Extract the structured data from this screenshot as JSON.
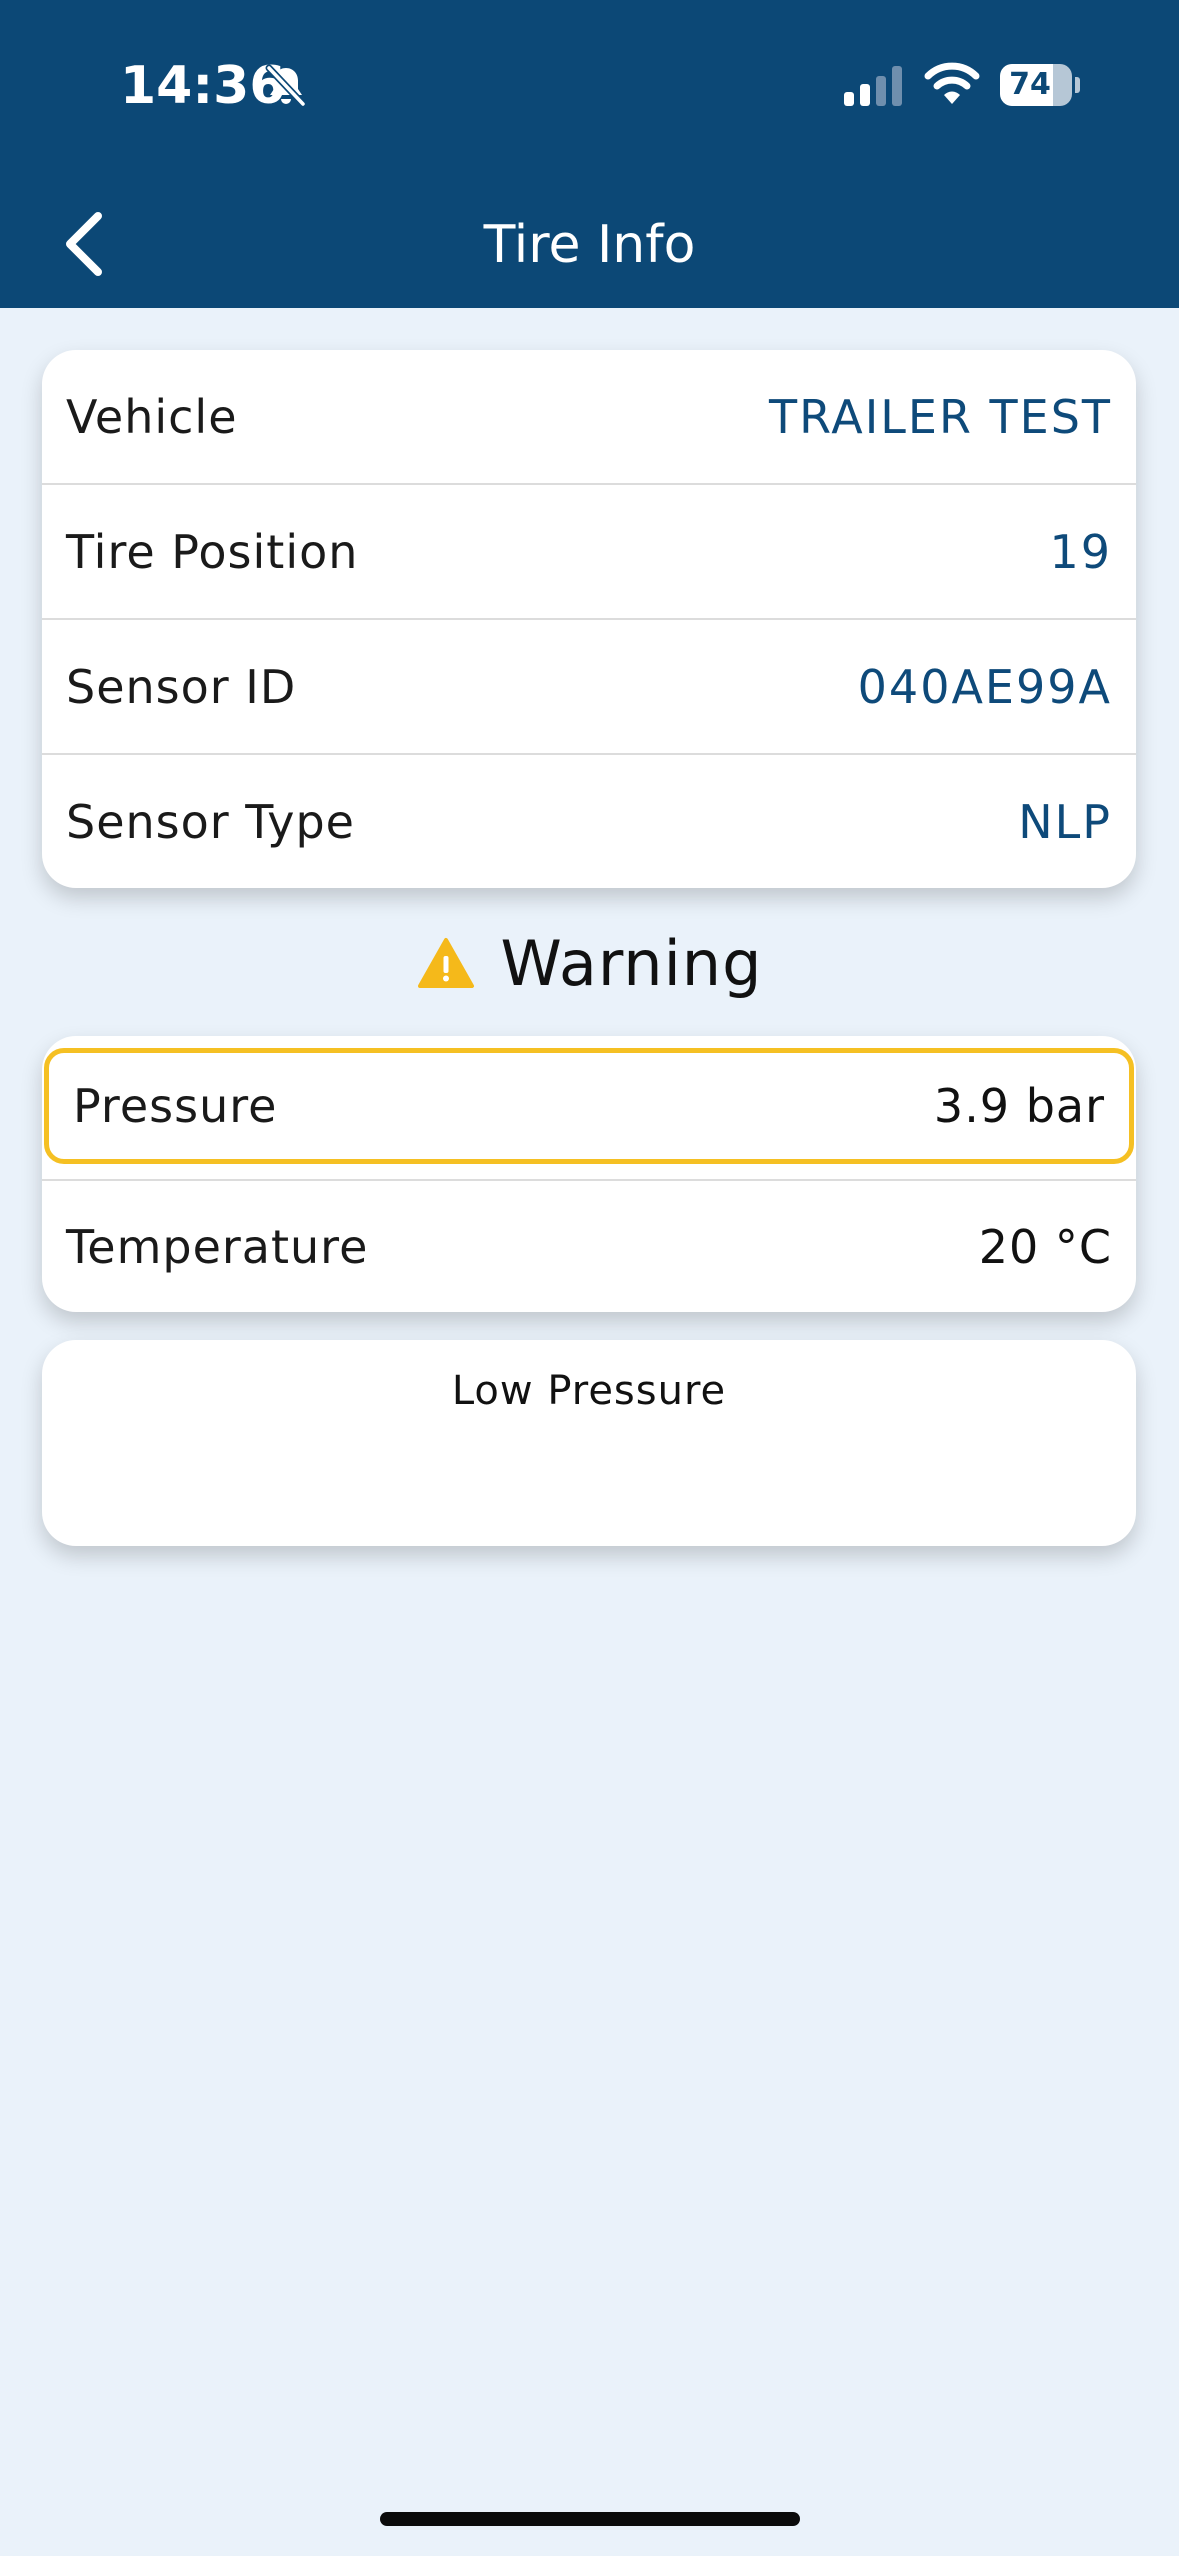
{
  "status_bar": {
    "time": "14:36",
    "battery": "74",
    "battery_level": 0.74
  },
  "header": {
    "title": "Tire Info"
  },
  "info": {
    "rows": [
      {
        "label": "Vehicle",
        "value": "TRAILER TEST"
      },
      {
        "label": "Tire Position",
        "value": "19"
      },
      {
        "label": "Sensor ID",
        "value": "040AE99A"
      },
      {
        "label": "Sensor Type",
        "value": "NLP"
      }
    ]
  },
  "warning": {
    "text": "Warning"
  },
  "readings": {
    "pressure_label": "Pressure",
    "pressure_value": "3.9 bar",
    "temperature_label": "Temperature",
    "temperature_value": "20 °C"
  },
  "alert": {
    "text": "Low Pressure"
  },
  "colors": {
    "header_bg": "#0c4876",
    "page_bg": "#eaf2fa",
    "value_blue": "#0e4a7a",
    "warning_yellow": "#f5c023"
  }
}
